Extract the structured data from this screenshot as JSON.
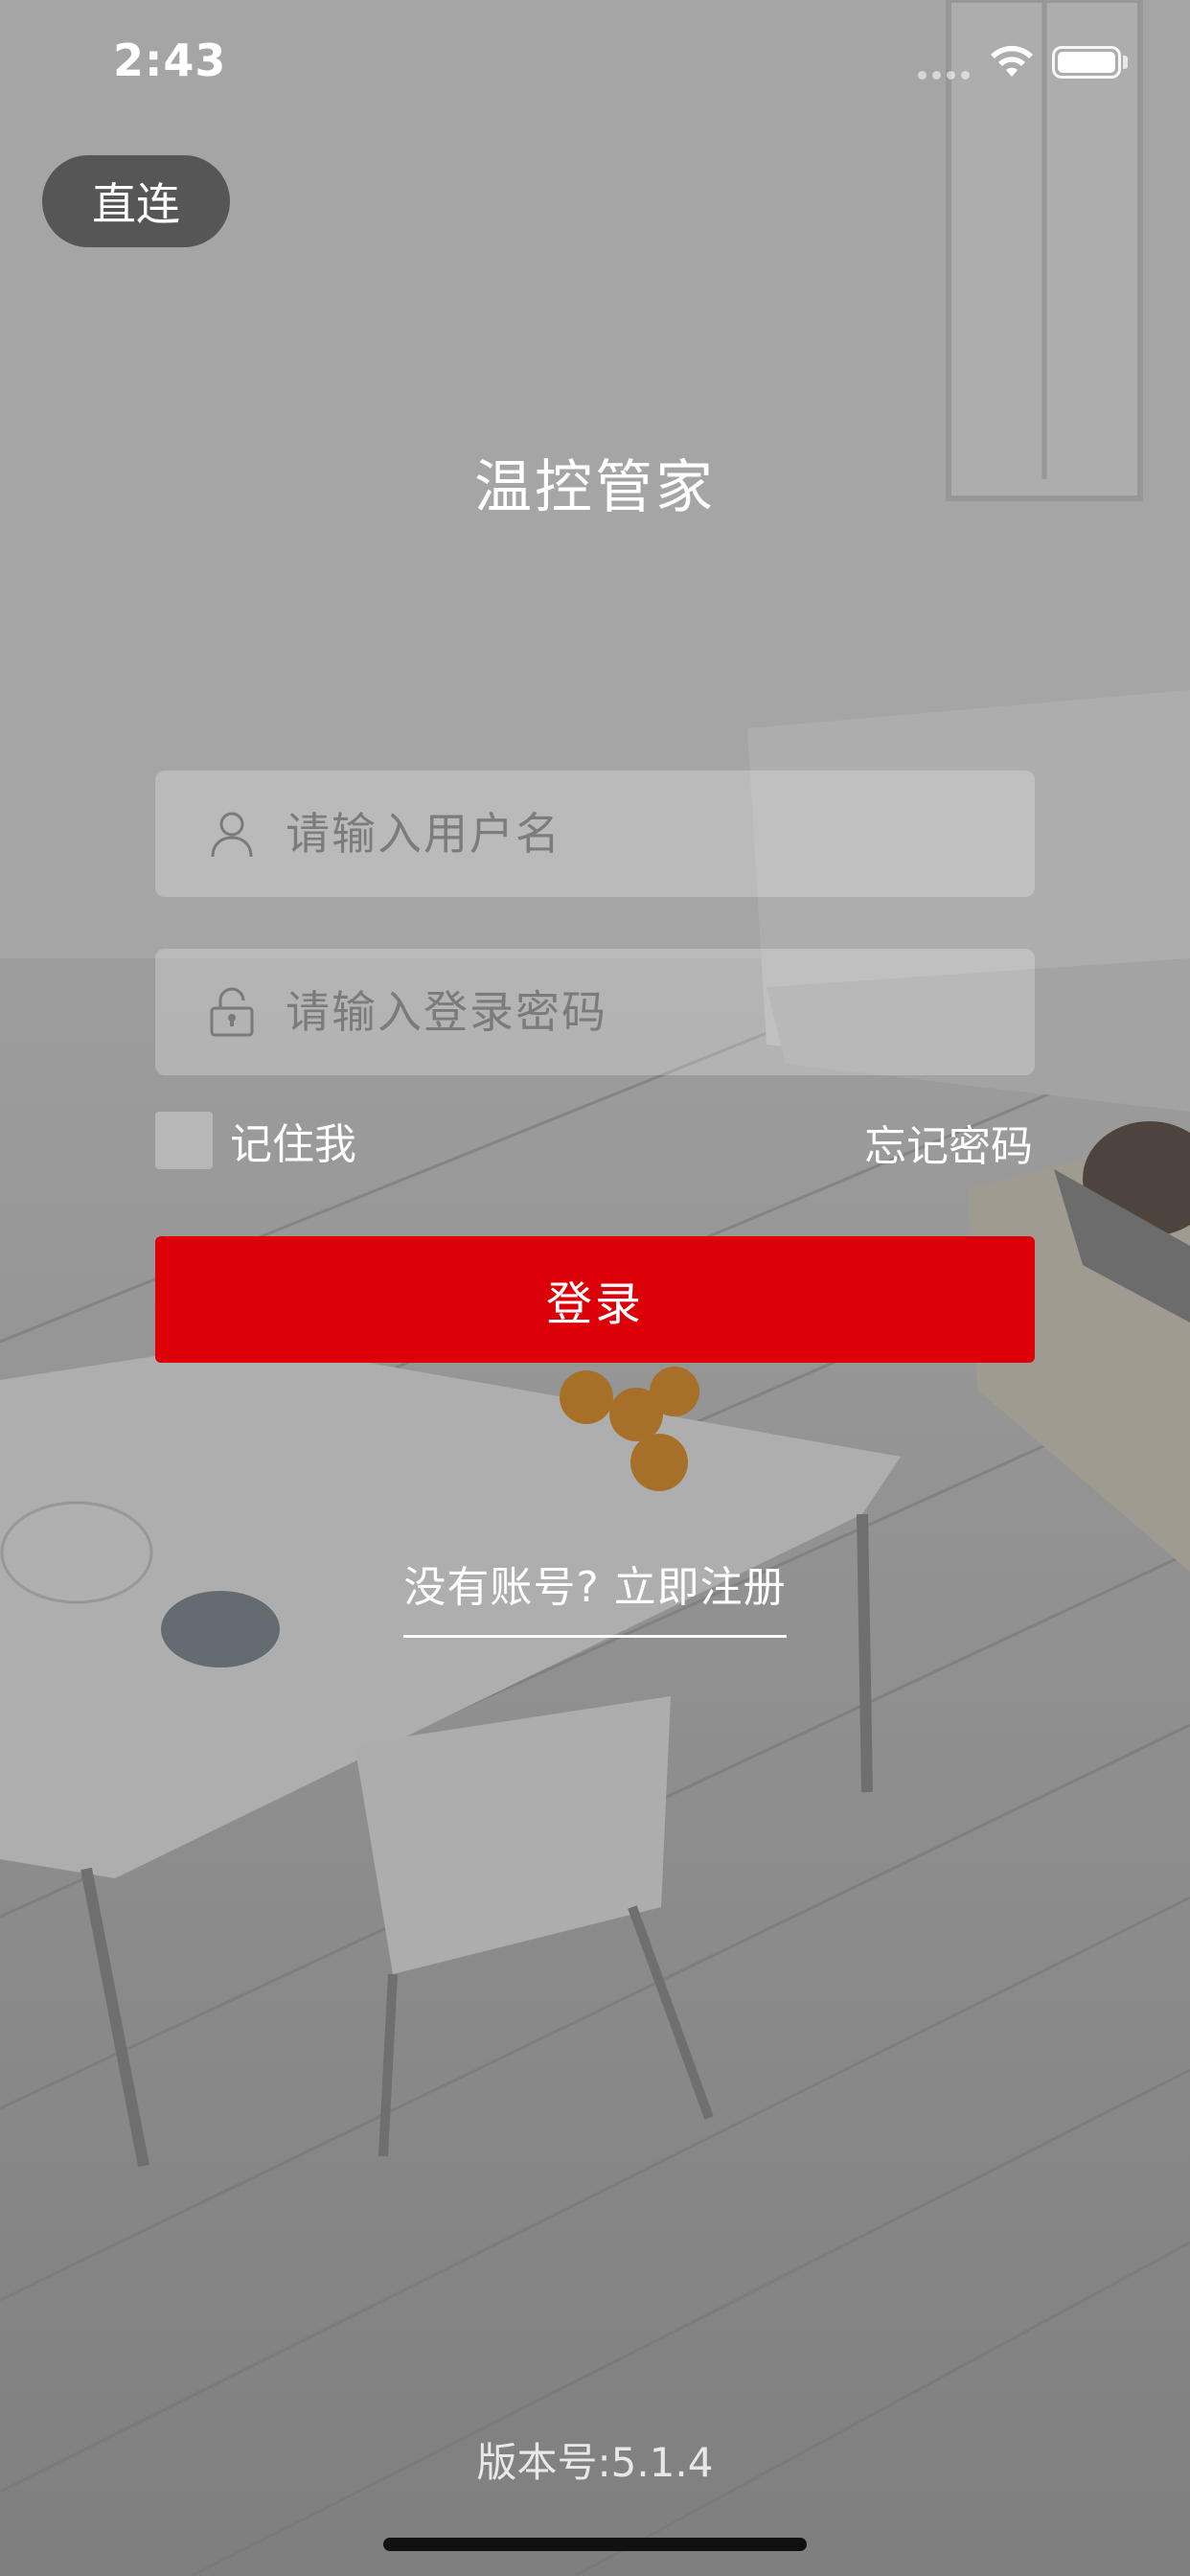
{
  "status_bar": {
    "time": "2:43"
  },
  "header": {
    "direct_connect_label": "直连",
    "app_title": "温控管家"
  },
  "form": {
    "username_placeholder": "请输入用户名",
    "username_value": "",
    "password_placeholder": "请输入登录密码",
    "password_value": "",
    "remember_label": "记住我",
    "remember_checked": false,
    "forgot_label": "忘记密码",
    "login_label": "登录",
    "register_label": "没有账号? 立即注册"
  },
  "footer": {
    "version": "版本号:5.1.4"
  },
  "colors": {
    "primary": "#dc0008",
    "text": "#ffffff"
  },
  "icons": {
    "username": "user-icon",
    "password": "lock-icon"
  }
}
